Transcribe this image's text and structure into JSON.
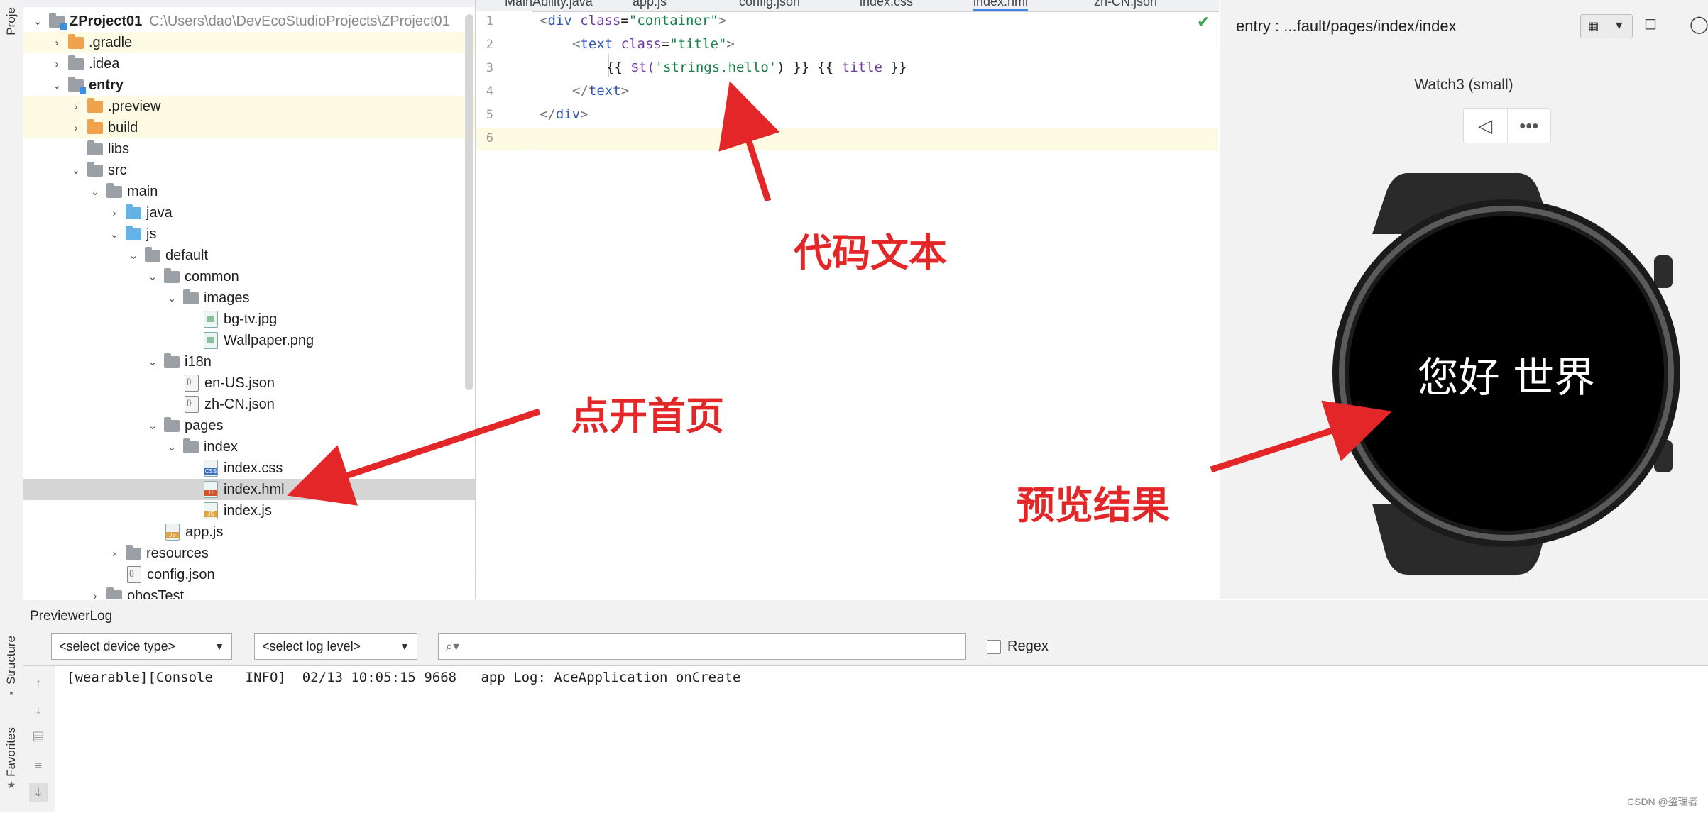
{
  "left_strip": {
    "project_tab": "Proje",
    "structure_tab": "Structure",
    "favorites_tab": "Favorites"
  },
  "editor_tabs": [
    "MainAbility.java",
    "app.js",
    "config.json",
    "index.css",
    "index.hml",
    "zh-CN.json"
  ],
  "project_tree": [
    {
      "label": "ZProject01",
      "hint": "C:\\Users\\dao\\DevEcoStudioProjects\\ZProject01",
      "depth": 0,
      "chev": "v",
      "icon": "mod",
      "bold": true
    },
    {
      "label": ".gradle",
      "depth": 1,
      "chev": ">",
      "icon": "orange",
      "hl": true
    },
    {
      "label": ".idea",
      "depth": 1,
      "chev": ">",
      "icon": "gray"
    },
    {
      "label": "entry",
      "depth": 1,
      "chev": "v",
      "icon": "mod",
      "bold": true
    },
    {
      "label": ".preview",
      "depth": 2,
      "chev": ">",
      "icon": "orange",
      "hl": true
    },
    {
      "label": "build",
      "depth": 2,
      "chev": ">",
      "icon": "orange",
      "hl": true
    },
    {
      "label": "libs",
      "depth": 2,
      "chev": "",
      "icon": "gray"
    },
    {
      "label": "src",
      "depth": 2,
      "chev": "v",
      "icon": "gray"
    },
    {
      "label": "main",
      "depth": 3,
      "chev": "v",
      "icon": "gray"
    },
    {
      "label": "java",
      "depth": 4,
      "chev": ">",
      "icon": "blue"
    },
    {
      "label": "js",
      "depth": 4,
      "chev": "v",
      "icon": "blue"
    },
    {
      "label": "default",
      "depth": 5,
      "chev": "v",
      "icon": "gray"
    },
    {
      "label": "common",
      "depth": 6,
      "chev": "v",
      "icon": "gray"
    },
    {
      "label": "images",
      "depth": 7,
      "chev": "v",
      "icon": "gray"
    },
    {
      "label": "bg-tv.jpg",
      "depth": 8,
      "chev": "",
      "icon": "img"
    },
    {
      "label": "Wallpaper.png",
      "depth": 8,
      "chev": "",
      "icon": "img"
    },
    {
      "label": "i18n",
      "depth": 6,
      "chev": "v",
      "icon": "gray"
    },
    {
      "label": "en-US.json",
      "depth": 7,
      "chev": "",
      "icon": "json"
    },
    {
      "label": "zh-CN.json",
      "depth": 7,
      "chev": "",
      "icon": "json"
    },
    {
      "label": "pages",
      "depth": 6,
      "chev": "v",
      "icon": "gray"
    },
    {
      "label": "index",
      "depth": 7,
      "chev": "v",
      "icon": "gray"
    },
    {
      "label": "index.css",
      "depth": 8,
      "chev": "",
      "icon": "css"
    },
    {
      "label": "index.hml",
      "depth": 8,
      "chev": "",
      "icon": "hml",
      "sel": true
    },
    {
      "label": "index.js",
      "depth": 8,
      "chev": "",
      "icon": "js"
    },
    {
      "label": "app.js",
      "depth": 6,
      "chev": "",
      "icon": "js"
    },
    {
      "label": "resources",
      "depth": 4,
      "chev": ">",
      "icon": "gray"
    },
    {
      "label": "config.json",
      "depth": 4,
      "chev": "",
      "icon": "json"
    },
    {
      "label": "ohosTest",
      "depth": 3,
      "chev": ">",
      "icon": "gray"
    }
  ],
  "editor": {
    "line_numbers": [
      "1",
      "2",
      "3",
      "4",
      "5",
      "6"
    ],
    "code": {
      "l1_open": "<",
      "l1_tag": "div",
      "l1_attr": " class",
      "l1_eq": "=",
      "l1_val": "\"container\"",
      "l1_close": ">",
      "l2_open": "<",
      "l2_tag": "text",
      "l2_attr": " class",
      "l2_eq": "=",
      "l2_val": "\"title\"",
      "l2_close": ">",
      "l3_a": "{{ ",
      "l3_fn": "$t(",
      "l3_str": "'strings.hello'",
      "l3_b": ") }} {{ ",
      "l3_var": "title",
      "l3_c": " }}",
      "l4_open": "</",
      "l4_tag": "text",
      "l4_close": ">",
      "l5_open": "</",
      "l5_tag": "div",
      "l5_close": ">"
    },
    "status_icon": "check-icon"
  },
  "previewer": {
    "path": "entry : ...fault/pages/index/index",
    "device_label": "Watch3 (small)",
    "screen_text": "您好 世界"
  },
  "annotations": {
    "code_text": "代码文本",
    "open_home": "点开首页",
    "preview_result": "预览结果"
  },
  "log": {
    "title": "PreviewerLog",
    "device_type": "<select device type>",
    "log_level": "<select log level>",
    "search_placeholder": "",
    "regex_label": "Regex",
    "line": "[wearable][Console    INFO]  02/13 10:05:15 9668   app Log: AceApplication onCreate"
  },
  "watermark": "CSDN @盗理者",
  "colors": {
    "accent": "#3f86e8",
    "annotation": "#e32627",
    "highlight_row": "#fdfbe3",
    "selected_row": "#d5d5d5"
  }
}
